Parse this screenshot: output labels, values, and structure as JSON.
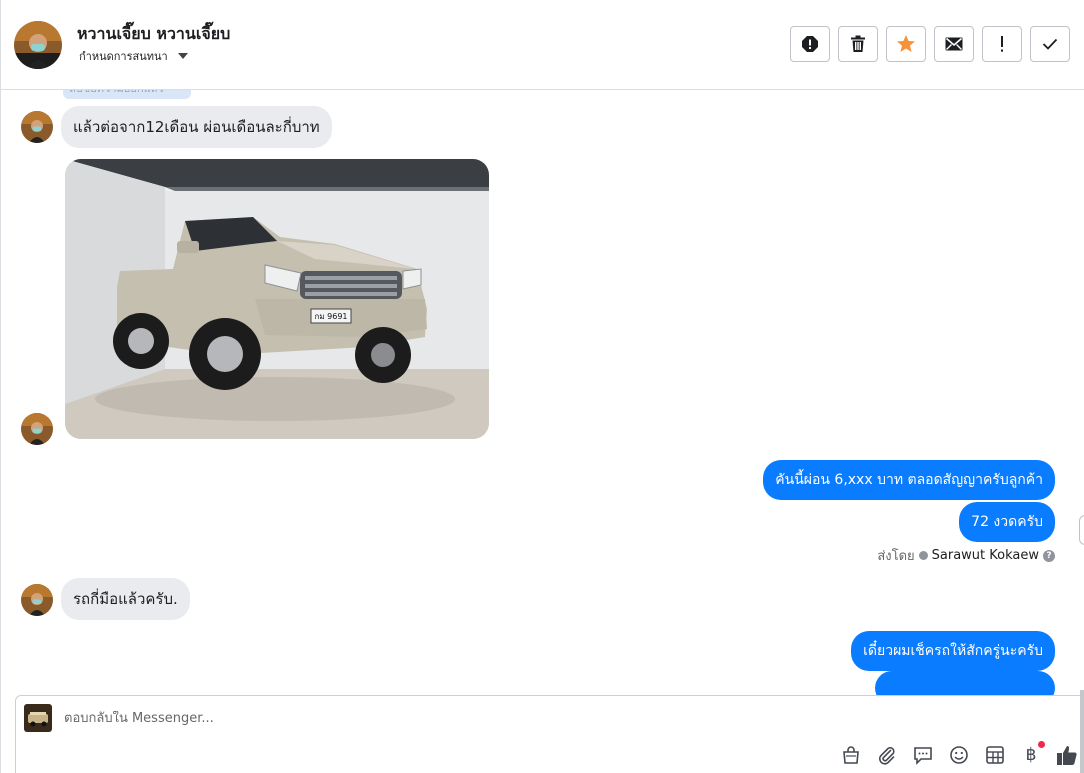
{
  "header": {
    "contact_name": "หวานเจี๊ยบ หวานเจี๊ยบ",
    "subtitle": "กำหนดการสนทนา",
    "toolbar": [
      {
        "name": "report-spam-icon",
        "tooltip": "alert"
      },
      {
        "name": "trash-icon",
        "tooltip": "delete"
      },
      {
        "name": "star-icon",
        "tooltip": "star"
      },
      {
        "name": "mail-icon",
        "tooltip": "mark unread"
      },
      {
        "name": "exclamation-icon",
        "tooltip": "follow up"
      },
      {
        "name": "checkmark-icon",
        "tooltip": "done"
      }
    ]
  },
  "messages": {
    "peek_text": "ลบข้อความออกแล้ว",
    "incoming_1": "แล้วต่อจาก12เดือน ผ่อนเดือนละกี่บาท",
    "outgoing_1": "คันนี้ผ่อน 6,xxx บาท ตลอดสัญญาครับลูกค้า",
    "outgoing_2": "72 งวดครับ",
    "sent_by_label": "ส่งโดย",
    "sent_by_name": "Sarawut Kokaew",
    "incoming_2": "รถกี่มือแล้วครับ.",
    "outgoing_3": "เดี๋ยวผมเช็ครถให้สักครู่นะครับ"
  },
  "photo": {
    "plate_text": "กม 9691"
  },
  "composer": {
    "placeholder": "ตอบกลับใน Messenger...",
    "tools": [
      "bag-icon",
      "paperclip-icon",
      "chat-icon",
      "emoji-icon",
      "table-icon",
      "baht-icon",
      "like-icon"
    ]
  },
  "colors": {
    "accent": "#0a7cff",
    "incoming_bubble": "#e9ebee",
    "star": "#f7923b"
  }
}
